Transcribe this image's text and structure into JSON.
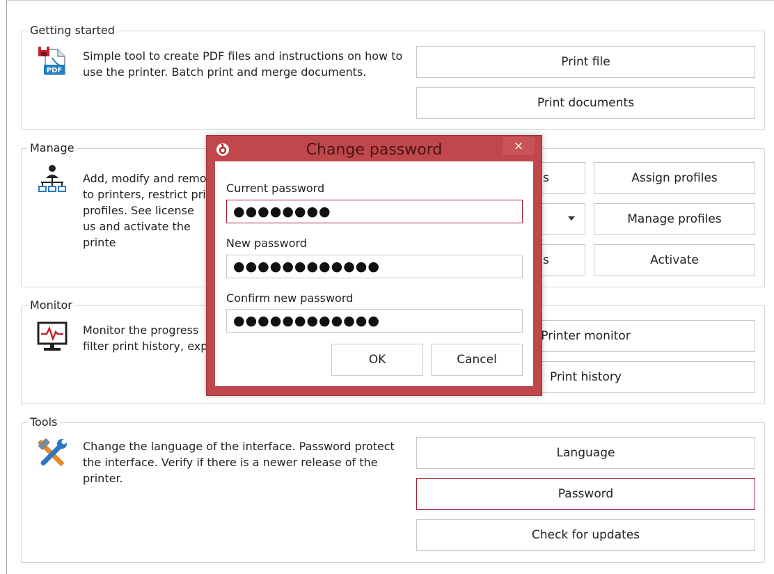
{
  "sections": {
    "getting_started": {
      "title": "Getting started",
      "description": "Simple tool to create PDF files and instructions on how to use the printer. Batch print and merge documents.",
      "buttons": [
        "Print file",
        "Print documents"
      ]
    },
    "manage": {
      "title": "Manage",
      "description": "Add, modify and remo to printers, restrict pri profiles. See license us and activate the printe",
      "buttons_left_partial": [
        "s",
        "",
        "s"
      ],
      "buttons_right": [
        "Assign profiles",
        "Manage profiles",
        "Activate"
      ]
    },
    "monitor": {
      "title": "Monitor",
      "description": "Monitor the progress filter print history, exp",
      "buttons": [
        "Printer monitor",
        "Print history"
      ]
    },
    "tools": {
      "title": "Tools",
      "description": "Change the language of the interface. Password protect the interface. Verify if there is a newer release of the printer.",
      "buttons": [
        "Language",
        "Password",
        "Check for updates"
      ]
    }
  },
  "dialog": {
    "title": "Change password",
    "close_glyph": "×",
    "current_password_label": "Current password",
    "current_password_value": "●●●●●●●●",
    "new_password_label": "New password",
    "new_password_value": "●●●●●●●●●●●●",
    "confirm_password_label": "Confirm new password",
    "confirm_password_value": "●●●●●●●●●●●●",
    "ok_label": "OK",
    "cancel_label": "Cancel"
  },
  "icons": {
    "getting_started": "pdf-file-icon",
    "manage": "network-users-icon",
    "monitor": "monitor-pulse-icon",
    "tools": "wrench-hammer-icon",
    "dialog_logo": "app-logo-icon"
  },
  "colors": {
    "accent": "#a5223a",
    "dialog_frame": "#c0484c",
    "border": "#c6c6c6"
  }
}
